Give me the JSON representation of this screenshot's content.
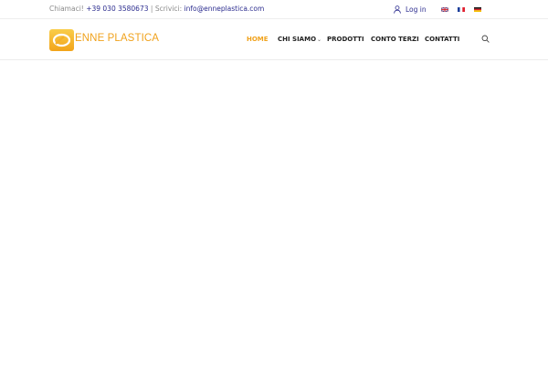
{
  "topbar": {
    "call_label": "Chiamaci!",
    "phone": "+39 030 3580673",
    "separator": "|",
    "write_label": "Scrivici:",
    "email": "info@enneplastica.com",
    "login_label": "Log in",
    "languages": [
      {
        "code": "en",
        "icon": "uk-flag-icon"
      },
      {
        "code": "fr",
        "icon": "france-flag-icon"
      },
      {
        "code": "de",
        "icon": "germany-flag-icon"
      }
    ]
  },
  "header": {
    "logo_text": "ENNE PLASTICA",
    "nav": [
      {
        "label": "HOME",
        "active": true
      },
      {
        "label": "CHI SIAMO",
        "has_dropdown": true
      },
      {
        "label": "PRODOTTI"
      },
      {
        "label": "CONTO TERZI"
      },
      {
        "label": "CONTATTI"
      }
    ],
    "search_icon": "search-icon"
  },
  "colors": {
    "accent": "#f0a21c",
    "link": "#2c2d8f",
    "muted_text": "#8a8a8a",
    "nav_text": "#222222"
  }
}
